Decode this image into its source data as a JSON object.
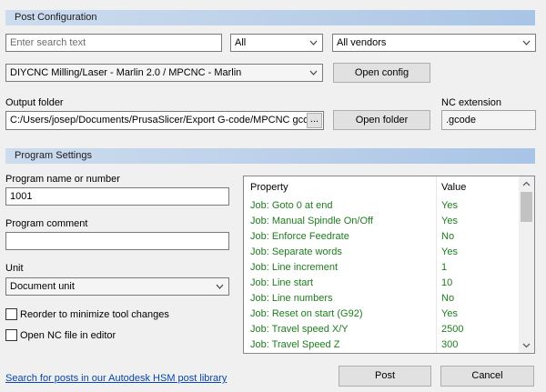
{
  "post_config": {
    "header": "Post Configuration",
    "search_placeholder": "Enter search text",
    "filter_type": "All",
    "filter_vendor": "All vendors",
    "post_selected": "DIYCNC Milling/Laser - Marlin 2.0 / MPCNC - Marlin",
    "open_config_label": "Open config",
    "output_folder_label": "Output folder",
    "output_folder_value": "C:/Users/josep/Documents/PrusaSlicer/Export G-code/MPCNC gcode",
    "browse_label": "...",
    "open_folder_label": "Open folder",
    "nc_extension_label": "NC extension",
    "nc_extension_value": ".gcode"
  },
  "program_settings": {
    "header": "Program Settings",
    "program_name_label": "Program name or number",
    "program_name_value": "1001",
    "program_comment_label": "Program comment",
    "program_comment_value": "",
    "unit_label": "Unit",
    "unit_value": "Document unit",
    "reorder_label": "Reorder to minimize tool changes",
    "open_nc_label": "Open NC file in editor"
  },
  "properties": {
    "col_property": "Property",
    "col_value": "Value",
    "rows": [
      {
        "property": "Job: Goto 0 at end",
        "value": "Yes"
      },
      {
        "property": "Job: Manual Spindle On/Off",
        "value": "Yes"
      },
      {
        "property": "Job: Enforce Feedrate",
        "value": "No"
      },
      {
        "property": "Job: Separate words",
        "value": "Yes"
      },
      {
        "property": "Job: Line increment",
        "value": "1"
      },
      {
        "property": "Job: Line start",
        "value": "10"
      },
      {
        "property": "Job: Line numbers",
        "value": "No"
      },
      {
        "property": "Job: Reset on start (G92)",
        "value": "Yes"
      },
      {
        "property": "Job: Travel speed X/Y",
        "value": "2500"
      },
      {
        "property": "Job: Travel Speed Z",
        "value": "300"
      }
    ]
  },
  "footer": {
    "library_link": "Search for posts in our Autodesk HSM post library",
    "post_label": "Post",
    "cancel_label": "Cancel"
  },
  "colors": {
    "property_text": "#1e7b1e",
    "link": "#0645ad",
    "header_gradient_end": "#a8c4e6"
  },
  "icons": {
    "dropdown": "chevron-down-icon",
    "scroll_up": "scroll-up-arrow-icon",
    "scroll_down": "scroll-down-arrow-icon"
  }
}
